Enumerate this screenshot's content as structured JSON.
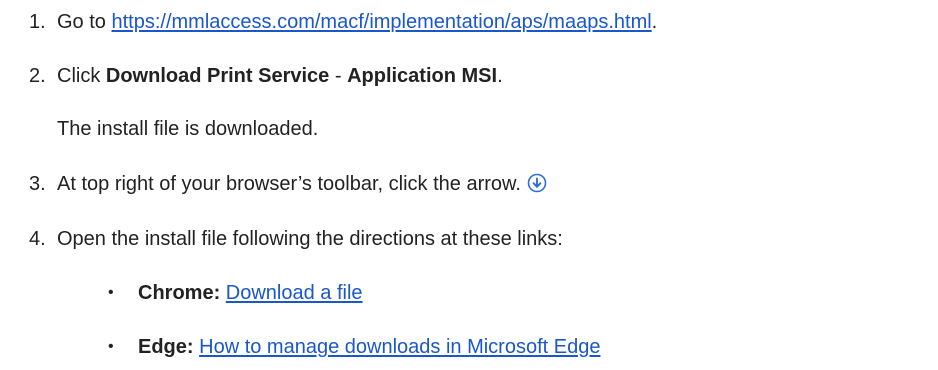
{
  "steps": [
    {
      "number": "1.",
      "prefix": "Go to ",
      "link": "https://mmlaccess.com/macf/implementation/aps/maaps.html",
      "suffix": "."
    },
    {
      "number": "2.",
      "prefix": "Click ",
      "bold1": "Download Print Service",
      "middle": " - ",
      "bold2": "Application MSI",
      "suffix": ".",
      "note": "The install file is downloaded."
    },
    {
      "number": "3.",
      "text": "At top right of your browser’s toolbar, click the arrow.",
      "icon": "download-arrow-icon"
    },
    {
      "number": "4.",
      "text": "Open the install file following the directions at these links:"
    }
  ],
  "browsers": [
    {
      "bullet": "•",
      "name": "Chrome:",
      "link": "Download a file"
    },
    {
      "bullet": "•",
      "name": "Edge:",
      "link": "How to manage downloads in Microsoft Edge"
    }
  ],
  "colors": {
    "link": "#1a56cc",
    "icon": "#2b6fd6",
    "text": "#222222"
  }
}
